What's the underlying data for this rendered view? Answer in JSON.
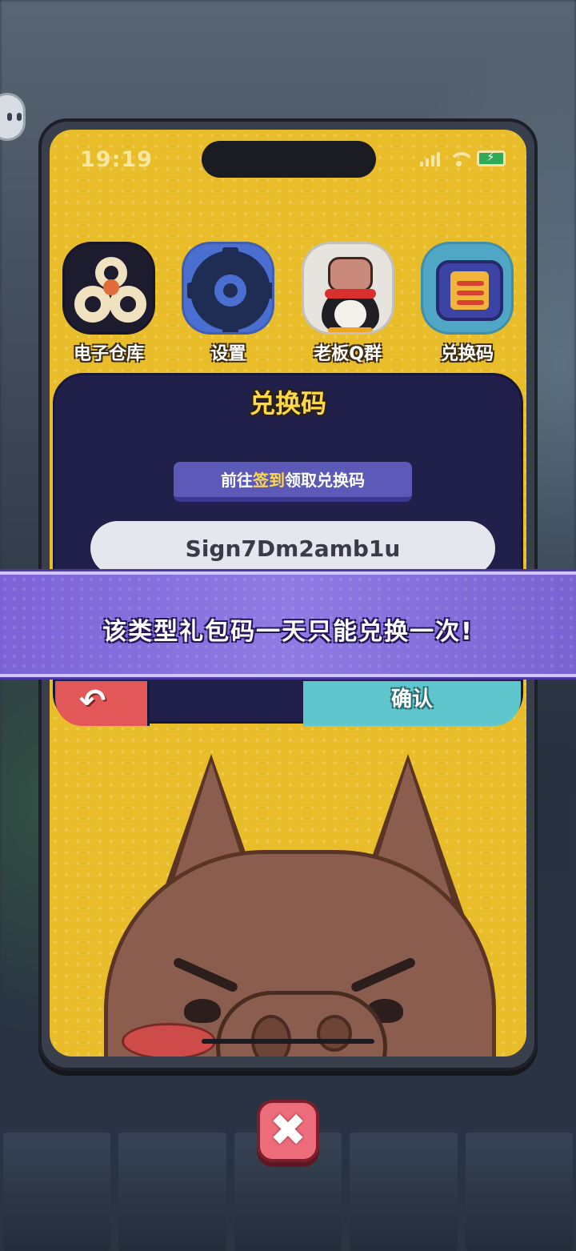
{
  "status_bar": {
    "time": "19:19",
    "icons": [
      "signal-icon",
      "wifi-icon",
      "battery-charging-icon"
    ]
  },
  "apps": [
    {
      "label": "电子仓库",
      "icon": "warehouse-icon"
    },
    {
      "label": "设置",
      "icon": "gear-icon"
    },
    {
      "label": "老板Q群",
      "icon": "penguin-icon"
    },
    {
      "label": "兑换码",
      "icon": "ticket-icon"
    }
  ],
  "redeem_panel": {
    "title": "兑换码",
    "checkin_prefix": "前往",
    "checkin_highlight": "签到",
    "checkin_suffix": "领取兑换码",
    "code_value": "Sign7Dm2amb1u",
    "confirm_label": "确认"
  },
  "toast": {
    "message": "该类型礼包码一天只能兑换一次!"
  },
  "colors": {
    "accent": "#ffd84a",
    "panel": "#21204a",
    "toast": "#8f7be3",
    "screen": "#e9bd2a"
  }
}
